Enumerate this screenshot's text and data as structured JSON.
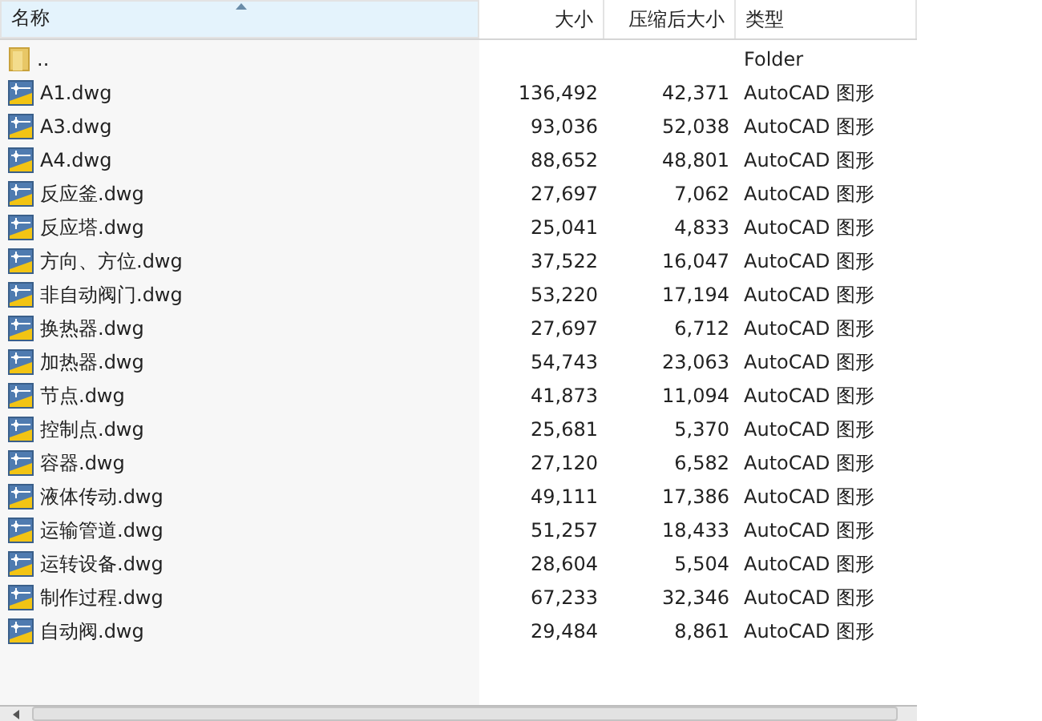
{
  "columns": [
    {
      "label": "名称",
      "sorted": true
    },
    {
      "label": "大小",
      "sorted": false
    },
    {
      "label": "压缩后大小",
      "sorted": false
    },
    {
      "label": "类型",
      "sorted": false
    }
  ],
  "rows": [
    {
      "kind": "folder",
      "name": "..",
      "size": "",
      "packed": "",
      "type": "Folder"
    },
    {
      "kind": "file",
      "name": "A1.dwg",
      "size": "136,492",
      "packed": "42,371",
      "type": "AutoCAD 图形"
    },
    {
      "kind": "file",
      "name": "A3.dwg",
      "size": "93,036",
      "packed": "52,038",
      "type": "AutoCAD 图形"
    },
    {
      "kind": "file",
      "name": "A4.dwg",
      "size": "88,652",
      "packed": "48,801",
      "type": "AutoCAD 图形"
    },
    {
      "kind": "file",
      "name": "反应釜.dwg",
      "size": "27,697",
      "packed": "7,062",
      "type": "AutoCAD 图形"
    },
    {
      "kind": "file",
      "name": "反应塔.dwg",
      "size": "25,041",
      "packed": "4,833",
      "type": "AutoCAD 图形"
    },
    {
      "kind": "file",
      "name": "方向、方位.dwg",
      "size": "37,522",
      "packed": "16,047",
      "type": "AutoCAD 图形"
    },
    {
      "kind": "file",
      "name": "非自动阀门.dwg",
      "size": "53,220",
      "packed": "17,194",
      "type": "AutoCAD 图形"
    },
    {
      "kind": "file",
      "name": "换热器.dwg",
      "size": "27,697",
      "packed": "6,712",
      "type": "AutoCAD 图形"
    },
    {
      "kind": "file",
      "name": "加热器.dwg",
      "size": "54,743",
      "packed": "23,063",
      "type": "AutoCAD 图形"
    },
    {
      "kind": "file",
      "name": "节点.dwg",
      "size": "41,873",
      "packed": "11,094",
      "type": "AutoCAD 图形"
    },
    {
      "kind": "file",
      "name": "控制点.dwg",
      "size": "25,681",
      "packed": "5,370",
      "type": "AutoCAD 图形"
    },
    {
      "kind": "file",
      "name": "容器.dwg",
      "size": "27,120",
      "packed": "6,582",
      "type": "AutoCAD 图形"
    },
    {
      "kind": "file",
      "name": "液体传动.dwg",
      "size": "49,111",
      "packed": "17,386",
      "type": "AutoCAD 图形"
    },
    {
      "kind": "file",
      "name": "运输管道.dwg",
      "size": "51,257",
      "packed": "18,433",
      "type": "AutoCAD 图形"
    },
    {
      "kind": "file",
      "name": "运转设备.dwg",
      "size": "28,604",
      "packed": "5,504",
      "type": "AutoCAD 图形"
    },
    {
      "kind": "file",
      "name": "制作过程.dwg",
      "size": "67,233",
      "packed": "32,346",
      "type": "AutoCAD 图形"
    },
    {
      "kind": "file",
      "name": "自动阀.dwg",
      "size": "29,484",
      "packed": "8,861",
      "type": "AutoCAD 图形"
    }
  ]
}
